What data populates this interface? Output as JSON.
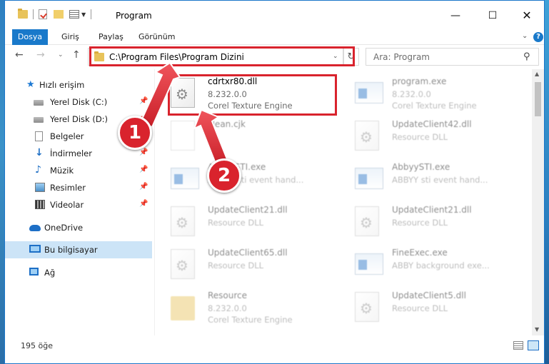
{
  "window": {
    "title": "Program",
    "controls": {
      "minimize": "—",
      "maximize": "☐",
      "close": "✕"
    }
  },
  "ribbon": {
    "tabs": [
      "Dosya",
      "Giriş",
      "Paylaş",
      "Görünüm"
    ],
    "help": "?"
  },
  "navigation": {
    "address": "C:\\Program Files\\Program Dizini",
    "search_placeholder": "Ara: Program"
  },
  "sidebar": {
    "items": [
      {
        "label": "Hızlı erişim",
        "icon": "star-icon",
        "pinned": false
      },
      {
        "label": "Yerel Disk (C:)",
        "icon": "disk-icon",
        "pinned": true
      },
      {
        "label": "Yerel Disk (D:)",
        "icon": "disk-icon",
        "pinned": true
      },
      {
        "label": "Belgeler",
        "icon": "document-icon",
        "pinned": true
      },
      {
        "label": "İndirmeler",
        "icon": "download-icon",
        "pinned": true
      },
      {
        "label": "Müzik",
        "icon": "music-icon",
        "pinned": true
      },
      {
        "label": "Resimler",
        "icon": "pictures-icon",
        "pinned": true
      },
      {
        "label": "Videolar",
        "icon": "video-icon",
        "pinned": true
      },
      {
        "label": "OneDrive",
        "icon": "cloud-icon",
        "pinned": false
      },
      {
        "label": "Bu bilgisayar",
        "icon": "computer-icon",
        "pinned": false,
        "selected": true
      },
      {
        "label": "Ağ",
        "icon": "network-icon",
        "pinned": false
      }
    ]
  },
  "files": [
    {
      "name": "cdrtxr80.dll",
      "line2": "8.232.0.0",
      "line3": "Corel Texture Engine",
      "icon": "dll-file-icon",
      "highlighted": true
    },
    {
      "name": "program.exe",
      "line2": "8.232.0.0",
      "line3": "Corel Texture Engine",
      "icon": "exe-file-icon"
    },
    {
      "name": "clean.cjk",
      "line2": "",
      "line3": "",
      "icon": "blank-file-icon"
    },
    {
      "name": "UpdateClient42.dll",
      "line2": "Resource DLL",
      "line3": "",
      "icon": "dll-file-icon"
    },
    {
      "name": "AbbyySTI.exe",
      "line2": "ABBYY sti event hand...",
      "line3": "",
      "icon": "exe-file-icon"
    },
    {
      "name": "AbbyySTI.exe",
      "line2": "ABBYY sti event hand...",
      "line3": "",
      "icon": "exe-file-icon"
    },
    {
      "name": "UpdateClient21.dll",
      "line2": "Resource DLL",
      "line3": "",
      "icon": "dll-file-icon"
    },
    {
      "name": "UpdateClient21.dll",
      "line2": "Resource DLL",
      "line3": "",
      "icon": "dll-file-icon"
    },
    {
      "name": "UpdateClient65.dll",
      "line2": "Resource DLL",
      "line3": "",
      "icon": "dll-file-icon"
    },
    {
      "name": "FineExec.exe",
      "line2": "ABBY background exe...",
      "line3": "",
      "icon": "exe-file-icon"
    },
    {
      "name": "Resource",
      "line2": "8.232.0.0",
      "line3": "Corel Texture Engine",
      "icon": "folder-icon"
    },
    {
      "name": "UpdateClient5.dll",
      "line2": "Resource DLL",
      "line3": "",
      "icon": "dll-file-icon"
    }
  ],
  "status": {
    "item_count": "195 öğe"
  },
  "annotations": {
    "step1": "1",
    "step2": "2",
    "accent_color": "#d9232d"
  }
}
